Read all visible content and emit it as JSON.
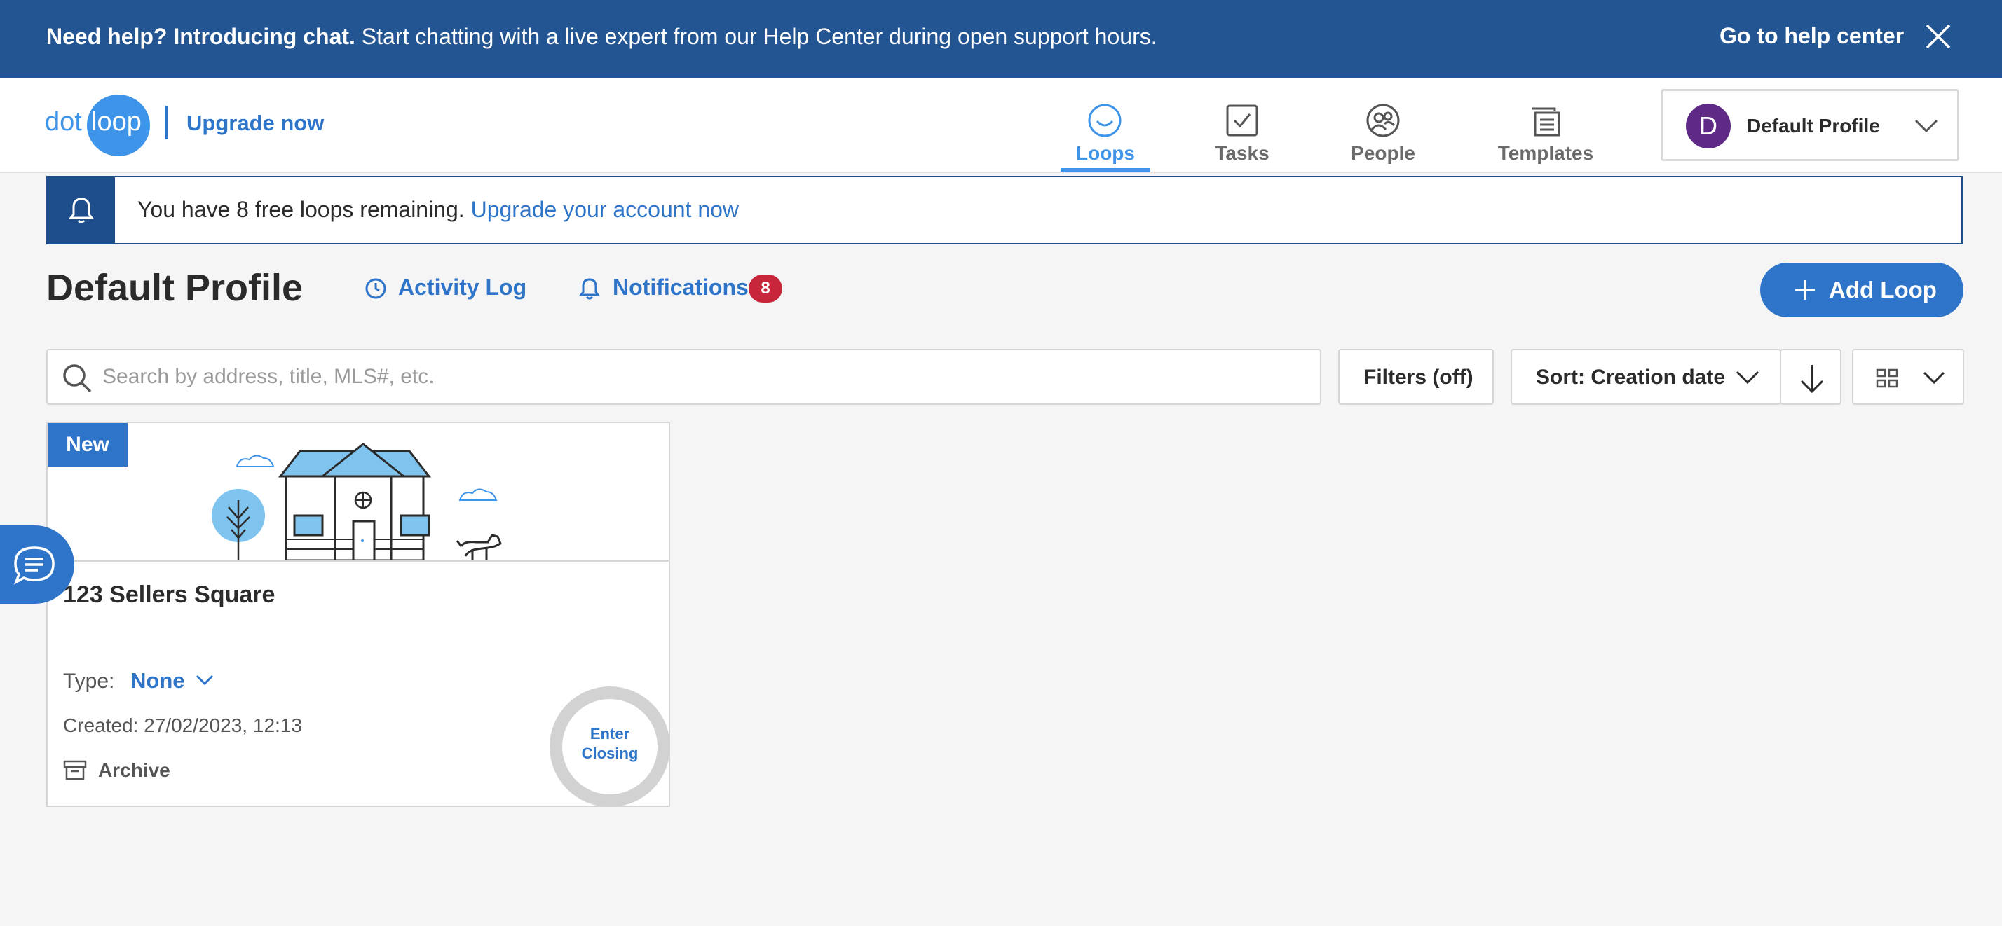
{
  "banner": {
    "bold_text": "Need help? Introducing chat.",
    "text": " Start chatting with a live expert from our Help Center during open support hours.",
    "link": "Go to help center"
  },
  "logo": {
    "part1": "dot",
    "part2": "loop"
  },
  "upgrade_label": "Upgrade now",
  "nav": {
    "loops": "Loops",
    "tasks": "Tasks",
    "people": "People",
    "templates": "Templates"
  },
  "profile": {
    "initial": "D",
    "name": "Default Profile"
  },
  "alert": {
    "text": "You have 8 free loops remaining. ",
    "link": "Upgrade your account now"
  },
  "page": {
    "title": "Default Profile",
    "activity_log": "Activity Log",
    "notifications": "Notifications",
    "notifications_count": "8",
    "add_loop": "Add Loop"
  },
  "search": {
    "placeholder": "Search by address, title, MLS#, etc.",
    "value": ""
  },
  "controls": {
    "filters": "Filters (off)",
    "sort": "Sort: Creation date"
  },
  "loops": [
    {
      "badge": "New",
      "title": "123 Sellers Square",
      "type_label": "Type:",
      "type_value": "None",
      "created": "Created: 27/02/2023, 12:13",
      "archive": "Archive",
      "status_line1": "Enter",
      "status_line2": "Closing"
    }
  ],
  "colors": {
    "banner": "#235592",
    "accent": "#2e74c9",
    "logo": "#3d94e8",
    "badge_red": "#c8263a",
    "avatar": "#5e2a85"
  }
}
